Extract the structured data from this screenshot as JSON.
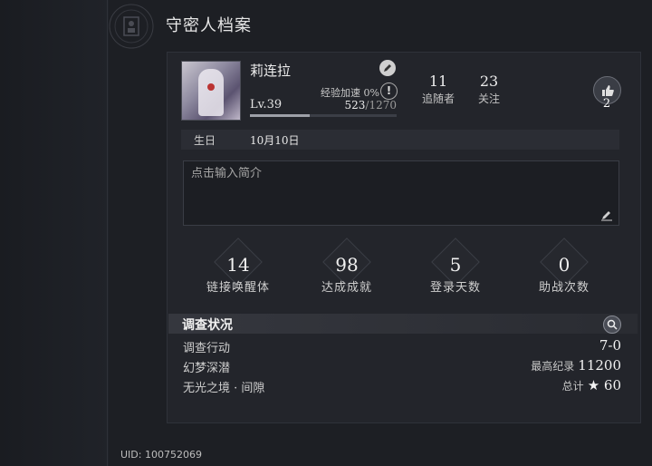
{
  "title": "守密人档案",
  "profile": {
    "name": "莉连拉",
    "exp_label": "经验加速 0%",
    "level": "Lv.39",
    "exp_current": "523",
    "exp_total": "/1270",
    "exp_progress": 0.41,
    "followers": {
      "value": "11",
      "label": "追随者"
    },
    "following": {
      "value": "23",
      "label": "关注"
    },
    "likes": "2",
    "birthday_label": "生日",
    "birthday": "10月10日",
    "bio_placeholder": "点击输入简介"
  },
  "stats": [
    {
      "value": "14",
      "label": "链接唤醒体"
    },
    {
      "value": "98",
      "label": "达成成就"
    },
    {
      "value": "5",
      "label": "登录天数"
    },
    {
      "value": "0",
      "label": "助战次数"
    }
  ],
  "investigation": {
    "title": "调查状况",
    "rows": [
      {
        "name": "调查行动",
        "sub": "",
        "value": "7-0"
      },
      {
        "name": "幻梦深潜",
        "sub": "最高纪录",
        "value": "11200"
      },
      {
        "name": "无光之境 · 间隙",
        "sub": "总计",
        "value": "★ 60"
      }
    ]
  },
  "uid": "UID: 100752069"
}
